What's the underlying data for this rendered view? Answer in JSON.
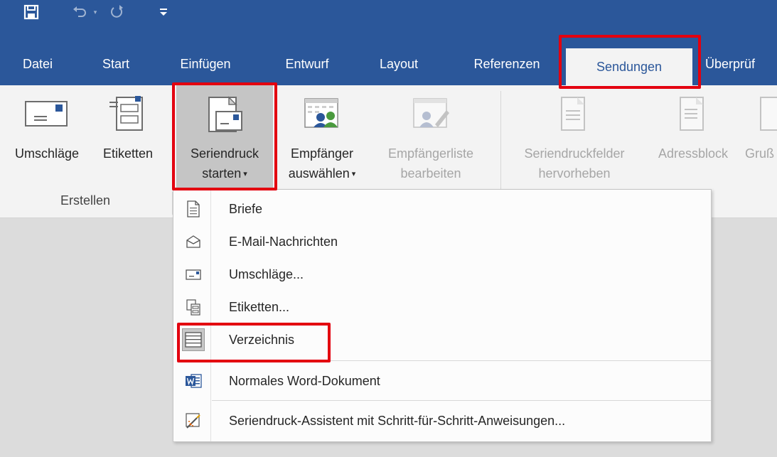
{
  "colors": {
    "brand": "#2b579a",
    "ribbon_bg": "#f3f3f3",
    "workspace": "#dcdcdc",
    "highlight": "#e3000f",
    "word_icon": "#2b579a"
  },
  "quick_access": {
    "save_icon": "save-icon",
    "undo_icon": "undo-icon",
    "redo_icon": "redo-icon",
    "customize_icon": "customize-qat-icon"
  },
  "tabs": [
    {
      "label": "Datei"
    },
    {
      "label": "Start"
    },
    {
      "label": "Einfügen"
    },
    {
      "label": "Entwurf"
    },
    {
      "label": "Layout"
    },
    {
      "label": "Referenzen"
    },
    {
      "label": "Sendungen",
      "active": true
    },
    {
      "label": "Überprüf"
    }
  ],
  "ribbon": {
    "umschlaege": "Umschläge",
    "etiketten": "Etiketten",
    "seriendruck_line1": "Seriendruck",
    "seriendruck_line2": "starten",
    "empfaenger_line1": "Empfänger",
    "empfaenger_line2": "auswählen",
    "empfaengerliste_line1": "Empfängerliste",
    "empfaengerliste_line2": "bearbeiten",
    "felder_line1": "Seriendruckfelder",
    "felder_line2": "hervorheben",
    "adressblock": "Adressblock",
    "gruss": "Gruß",
    "group_erstellen": "Erstellen"
  },
  "menu": {
    "items": [
      {
        "label": "Briefe",
        "icon": "document-icon"
      },
      {
        "label": "E-Mail-Nachrichten",
        "icon": "email-icon"
      },
      {
        "label": "Umschläge...",
        "icon": "envelope-icon"
      },
      {
        "label": "Etiketten...",
        "icon": "labels-icon"
      },
      {
        "label": "Verzeichnis",
        "icon": "directory-icon",
        "highlighted": true
      },
      {
        "label": "Normales Word-Dokument",
        "icon": "word-doc-icon"
      },
      {
        "label": "Seriendruck-Assistent mit Schritt-für-Schritt-Anweisungen...",
        "icon": "wizard-icon"
      }
    ]
  }
}
